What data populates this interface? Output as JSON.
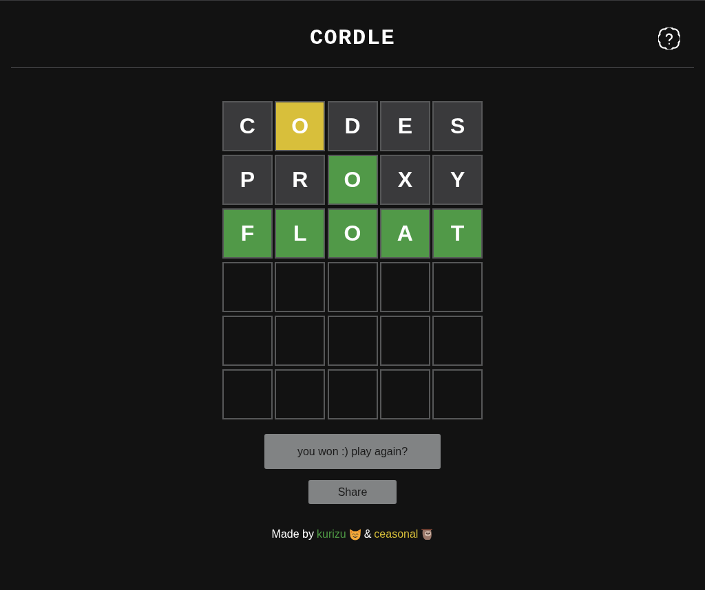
{
  "header": {
    "title": "CORDLE"
  },
  "board": {
    "rows": [
      {
        "tiles": [
          {
            "letter": "C",
            "kind": "absent"
          },
          {
            "letter": "O",
            "kind": "present"
          },
          {
            "letter": "D",
            "kind": "absent"
          },
          {
            "letter": "E",
            "kind": "absent"
          },
          {
            "letter": "S",
            "kind": "absent"
          }
        ]
      },
      {
        "tiles": [
          {
            "letter": "P",
            "kind": "absent"
          },
          {
            "letter": "R",
            "kind": "absent"
          },
          {
            "letter": "O",
            "kind": "correct"
          },
          {
            "letter": "X",
            "kind": "absent"
          },
          {
            "letter": "Y",
            "kind": "absent"
          }
        ]
      },
      {
        "tiles": [
          {
            "letter": "F",
            "kind": "correct"
          },
          {
            "letter": "L",
            "kind": "correct"
          },
          {
            "letter": "O",
            "kind": "correct"
          },
          {
            "letter": "A",
            "kind": "correct"
          },
          {
            "letter": "T",
            "kind": "correct"
          }
        ]
      },
      {
        "tiles": [
          {
            "kind": "empty"
          },
          {
            "kind": "empty"
          },
          {
            "kind": "empty"
          },
          {
            "kind": "empty"
          },
          {
            "kind": "empty"
          }
        ]
      },
      {
        "tiles": [
          {
            "kind": "empty"
          },
          {
            "kind": "empty"
          },
          {
            "kind": "empty"
          },
          {
            "kind": "empty"
          },
          {
            "kind": "empty"
          }
        ]
      },
      {
        "tiles": [
          {
            "kind": "empty"
          },
          {
            "kind": "empty"
          },
          {
            "kind": "empty"
          },
          {
            "kind": "empty"
          },
          {
            "kind": "empty"
          }
        ]
      }
    ]
  },
  "actions": {
    "play_again": "you won :) play again?",
    "share": "Share"
  },
  "footer": {
    "lead": "Made by",
    "joiner": "&",
    "authors": [
      {
        "name": "kurizu",
        "color": "#4f9a45"
      },
      {
        "name": "ceasonal",
        "color": "#d5bd3a"
      }
    ]
  }
}
